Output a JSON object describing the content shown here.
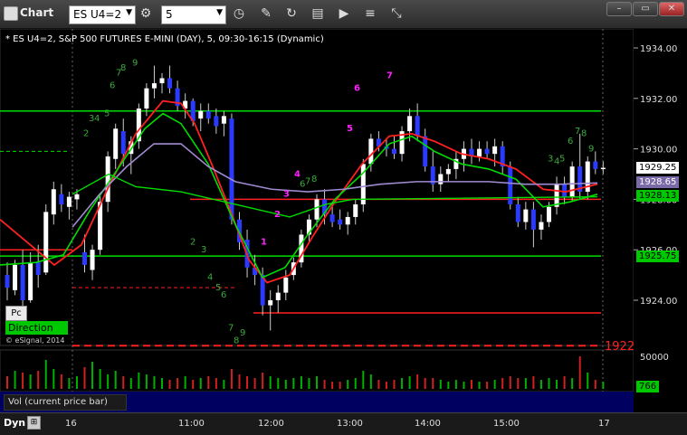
{
  "titlebar": {
    "title": "Chart",
    "symbol": "ES U4=2",
    "interval": "5",
    "window_buttons": [
      "–",
      "▭",
      "✕"
    ]
  },
  "chart": {
    "header": "* ES U4=2, S&P 500 FUTURES E-MINI (DAY), 5, 09:30-16:15 (Dynamic)",
    "copyright": "© eSignal, 2014",
    "pc_label": "Pc",
    "direction_label": "Direction",
    "price_axis": [
      "1934.00",
      "1932.00",
      "1930.00",
      "1928.00",
      "1926.00",
      "1924.00"
    ],
    "price_tags": [
      {
        "text": "1929.25",
        "bg": "#ffffff",
        "fg": "#000000"
      },
      {
        "text": "1928.65",
        "bg": "#7a6aa8",
        "fg": "#ffffff"
      },
      {
        "text": "1928.13",
        "bg": "#00c800",
        "fg": "#000000"
      },
      {
        "text": "1925.75",
        "bg": "#00c800",
        "fg": "#000000"
      }
    ],
    "level_1922": "1922",
    "vol_axis": [
      "50000",
      "766"
    ],
    "vol_label": "Vol (current price bar)",
    "time_axis": [
      "16",
      "11:00",
      "12:00",
      "13:00",
      "14:00",
      "15:00",
      "17"
    ],
    "magenta_counts": [
      "1",
      "2",
      "3",
      "4",
      "5",
      "6",
      "7"
    ],
    "green_counts": [
      "2",
      "3",
      "4",
      "5",
      "6",
      "7",
      "8",
      "9"
    ]
  },
  "bottombar": {
    "dyn": "Dyn"
  },
  "colors": {
    "bg": "#000000",
    "bull_candle": "#ffffff",
    "bear_candle": "#2a3aff",
    "red_line": "#ff2020",
    "green_line": "#00dd00",
    "purple_line": "#a08ad0",
    "count_magenta": "#ff20ff",
    "count_green": "#3aaa3a"
  }
}
